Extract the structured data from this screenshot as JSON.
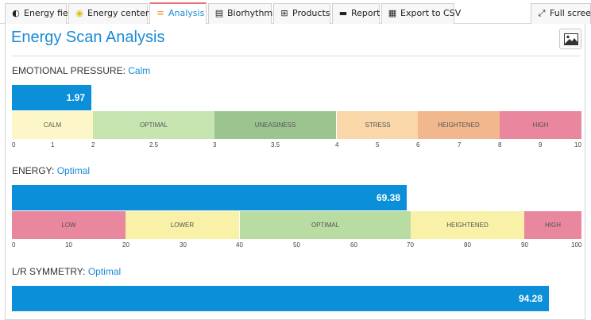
{
  "tabs": [
    {
      "label": "Energy field",
      "icon": "energy-field-icon",
      "glyph": "◐"
    },
    {
      "label": "Energy centers",
      "icon": "energy-centers-icon",
      "glyph": "◉"
    },
    {
      "label": "Analysis",
      "icon": "analysis-icon",
      "glyph": "≡"
    },
    {
      "label": "Biorhythms",
      "icon": "biorhythms-icon",
      "glyph": "▤"
    },
    {
      "label": "Products",
      "icon": "cart-icon",
      "glyph": "⊞"
    },
    {
      "label": "Report",
      "icon": "print-icon",
      "glyph": "▬"
    },
    {
      "label": "Export to CSV",
      "icon": "csv-icon",
      "glyph": "▦"
    }
  ],
  "fullscreen": {
    "label": "Full screen",
    "icon": "fullscreen-icon",
    "glyph": "⤢"
  },
  "page": {
    "title": "Energy Scan Analysis"
  },
  "colors": {
    "accent": "#1a8bd6",
    "bar": "#0a8fd8"
  },
  "sections": [
    {
      "label": "EMOTIONAL PRESSURE:",
      "status": "Calm",
      "value": "1.97",
      "fill_fraction": 0.14,
      "zones": [
        {
          "name": "CALM",
          "from": 0,
          "to": 0.142,
          "color": "#fdf6c8"
        },
        {
          "name": "OPTIMAL",
          "from": 0.142,
          "to": 0.356,
          "color": "#c6e5b1"
        },
        {
          "name": "UNEASINESS",
          "from": 0.356,
          "to": 0.57,
          "color": "#9cc48f"
        },
        {
          "name": "STRESS",
          "from": 0.57,
          "to": 0.713,
          "color": "#fad7a9"
        },
        {
          "name": "HEIGHTENED",
          "from": 0.713,
          "to": 0.856,
          "color": "#f1b88e"
        },
        {
          "name": "HIGH",
          "from": 0.856,
          "to": 1,
          "color": "#e8879e"
        }
      ],
      "ticks": [
        {
          "t": "0",
          "p": 0
        },
        {
          "t": "1",
          "p": 0.071
        },
        {
          "t": "2",
          "p": 0.142
        },
        {
          "t": "2.5",
          "p": 0.249
        },
        {
          "t": "3",
          "p": 0.356
        },
        {
          "t": "3.5",
          "p": 0.463
        },
        {
          "t": "4",
          "p": 0.57
        },
        {
          "t": "5",
          "p": 0.642
        },
        {
          "t": "6",
          "p": 0.713
        },
        {
          "t": "7",
          "p": 0.785
        },
        {
          "t": "8",
          "p": 0.856
        },
        {
          "t": "9",
          "p": 0.928
        },
        {
          "t": "10",
          "p": 1
        }
      ]
    },
    {
      "label": "ENERGY:",
      "status": "Optimal",
      "value": "69.38",
      "fill_fraction": 0.6938,
      "zones": [
        {
          "name": "LOW",
          "from": 0,
          "to": 0.2,
          "color": "#e8879e"
        },
        {
          "name": "LOWER",
          "from": 0.2,
          "to": 0.4,
          "color": "#f9f1a8"
        },
        {
          "name": "OPTIMAL",
          "from": 0.4,
          "to": 0.7,
          "color": "#b8dca2"
        },
        {
          "name": "HEIGHTENED",
          "from": 0.7,
          "to": 0.9,
          "color": "#f9f1a8"
        },
        {
          "name": "HIGH",
          "from": 0.9,
          "to": 1,
          "color": "#e8879e"
        }
      ],
      "ticks": [
        {
          "t": "0",
          "p": 0
        },
        {
          "t": "10",
          "p": 0.1
        },
        {
          "t": "20",
          "p": 0.2
        },
        {
          "t": "30",
          "p": 0.3
        },
        {
          "t": "40",
          "p": 0.4
        },
        {
          "t": "50",
          "p": 0.5
        },
        {
          "t": "60",
          "p": 0.6
        },
        {
          "t": "70",
          "p": 0.7
        },
        {
          "t": "80",
          "p": 0.8
        },
        {
          "t": "90",
          "p": 0.9
        },
        {
          "t": "100",
          "p": 1
        }
      ]
    },
    {
      "label": "L/R SYMMETRY:",
      "status": "Optimal",
      "value": "94.28",
      "fill_fraction": 0.9428
    }
  ]
}
